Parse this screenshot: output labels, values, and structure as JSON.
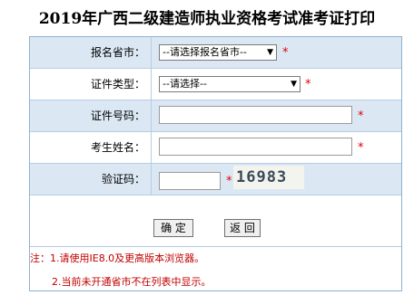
{
  "page": {
    "title": "2019年广西二级建造师执业资格考试准考证打印"
  },
  "form": {
    "province": {
      "label": "报名省市：",
      "value": "--请选择报名省市--"
    },
    "cert_type": {
      "label": "证件类型：",
      "value": "--请选择--"
    },
    "cert_no": {
      "label": "证件号码：",
      "value": ""
    },
    "name": {
      "label": "考生姓名：",
      "value": ""
    },
    "captcha": {
      "label": "验证码：",
      "value": "",
      "image_text": "16983"
    },
    "required_mark": "*"
  },
  "buttons": {
    "confirm": "确 定",
    "back": "返 回"
  },
  "notes": {
    "line1": "注：1.请使用IE8.0及更高版本浏览器。",
    "line2": "2.当前未开通省市不在列表中显示。"
  },
  "colors": {
    "required": "#e00000",
    "note": "#c00000",
    "row_shade": "#dbe8f4",
    "border": "#8fb1cf"
  }
}
